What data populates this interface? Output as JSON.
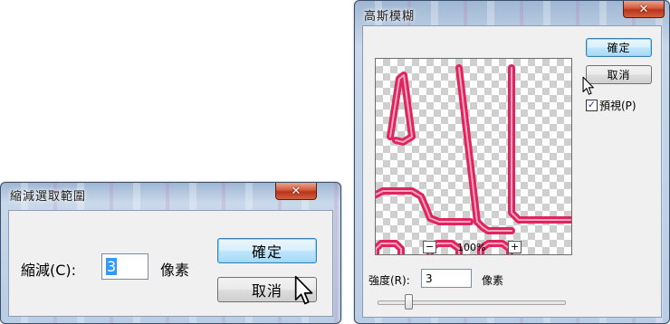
{
  "shrink_dialog": {
    "title": "縮減選取範圍",
    "close_glyph": "✕",
    "label": "縮減(C):",
    "value": "3",
    "unit": "像素",
    "ok_label": "確定",
    "cancel_label": "取消"
  },
  "blur_dialog": {
    "title": "高斯模糊",
    "close_glyph": "✕",
    "ok_label": "確定",
    "cancel_label": "取消",
    "preview_checkbox_label": "預視(P)",
    "preview_checked": true,
    "zoom_out_glyph": "−",
    "zoom_in_glyph": "+",
    "zoom_level": "100%",
    "radius_label": "強度(R):",
    "radius_value": "3",
    "radius_unit": "像素",
    "preview_stroke_color": "#e0245e"
  },
  "icons": {
    "cursor": "mouse-pointer-icon",
    "checkmark": "checkmark-icon"
  }
}
